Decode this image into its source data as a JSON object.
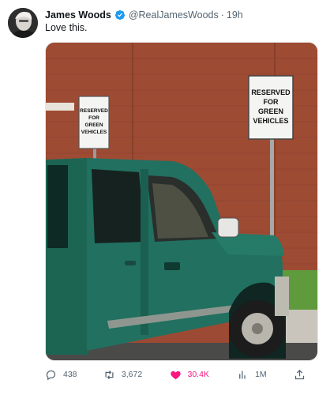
{
  "author": {
    "name": "James Woods",
    "handle": "@RealJamesWoods",
    "separator": "·",
    "time": "19h"
  },
  "tweet": {
    "text": "Love this."
  },
  "photo": {
    "sign_small": [
      "RESERVED",
      "FOR",
      "GREEN",
      "VEHICLES"
    ],
    "sign_large": [
      "RESERVED",
      "FOR",
      "GREEN",
      "VEHICLES"
    ]
  },
  "actions": {
    "replies": "438",
    "retweets": "3,672",
    "likes": "30.4K",
    "views": "1M"
  },
  "colors": {
    "verified": "#1d9bf0",
    "like_active": "#f91880",
    "muted": "#536471",
    "brick": "#9c4a33",
    "truck": "#1f6b5a"
  }
}
